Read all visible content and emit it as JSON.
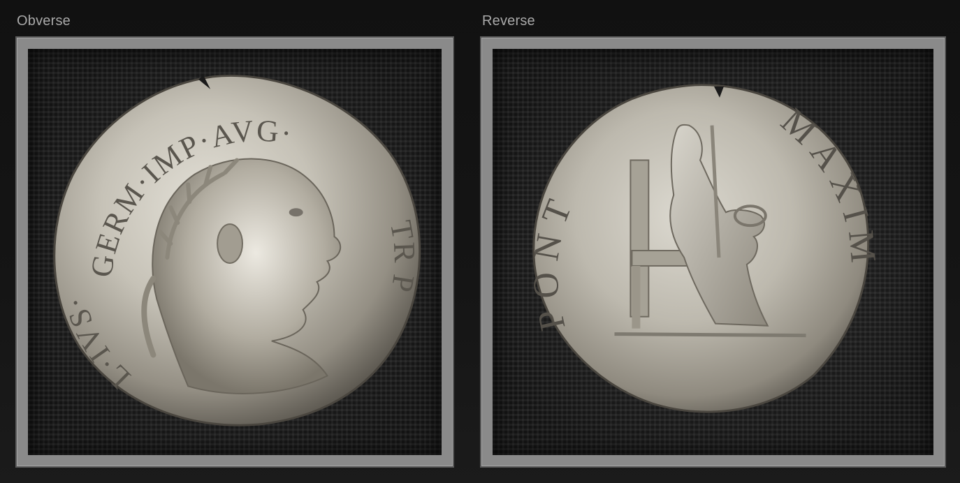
{
  "panels": {
    "obverse": {
      "label": "Obverse",
      "legend_left": "L·IVS·",
      "legend_top": "GERM·IMP·AVG·",
      "legend_right": "TR P"
    },
    "reverse": {
      "label": "Reverse",
      "legend_left": "PONT",
      "legend_right": "MAXIM"
    }
  },
  "colors": {
    "coin_silver": "#c9c6bd",
    "coin_shadow": "#6f6a60",
    "cloth": "#141414",
    "frame": "#8a8a8a"
  }
}
